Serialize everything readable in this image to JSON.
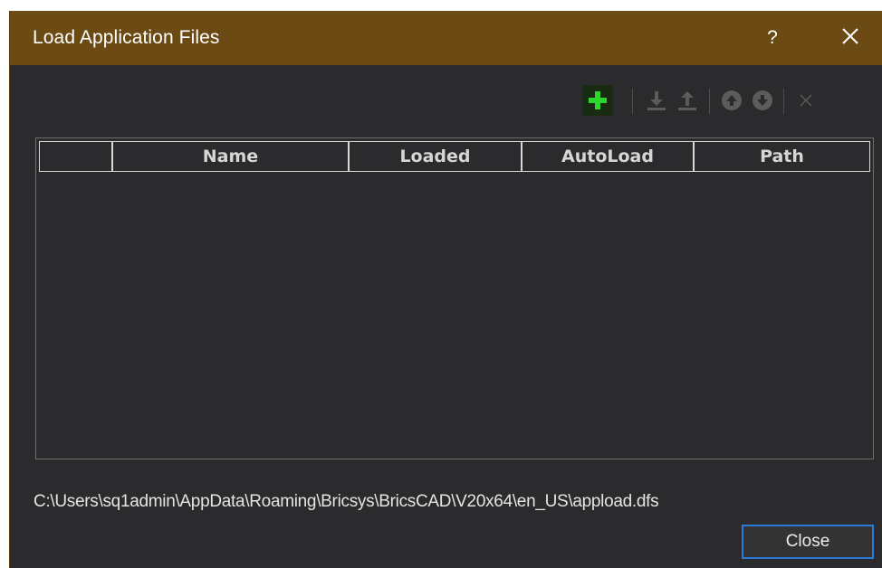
{
  "window": {
    "title": "Load Application Files",
    "help_label": "?"
  },
  "toolbar": {
    "items": [
      {
        "icon": "add-icon",
        "enabled": true,
        "color": "#2fd52f"
      },
      {
        "icon": "load-icon",
        "enabled": false
      },
      {
        "icon": "unload-icon",
        "enabled": false
      },
      {
        "icon": "move-up-icon",
        "enabled": false
      },
      {
        "icon": "move-down-icon",
        "enabled": false
      },
      {
        "icon": "remove-icon",
        "enabled": false
      }
    ]
  },
  "table": {
    "columns": [
      "",
      "Name",
      "Loaded",
      "AutoLoad",
      "Path"
    ],
    "rows": []
  },
  "file_path": "C:\\Users\\sq1admin\\AppData\\Roaming\\Bricsys\\BricsCAD\\V20x64\\en_US\\appload.dfs",
  "buttons": {
    "close_label": "Close"
  },
  "colors": {
    "titlebar": "#6b4a14",
    "background": "#2b2b2d",
    "accent": "#2a7ad8"
  }
}
